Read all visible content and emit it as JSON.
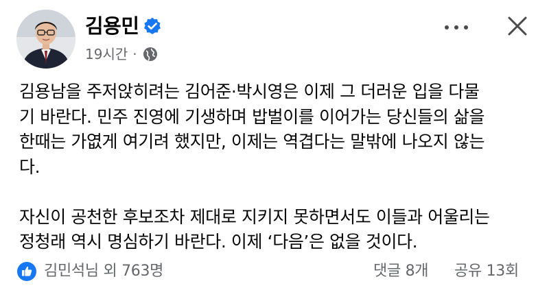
{
  "post": {
    "author": {
      "name": "김용민",
      "verified": true,
      "avatar": "profile-photo"
    },
    "meta": {
      "time": "19시간",
      "separator": "·",
      "audience_icon": "globe-icon"
    },
    "actions": {
      "more_icon": "more-icon",
      "close_icon": "close-icon"
    },
    "body": {
      "paragraph_1_lines": [
        "김용남을 주저앉히려는 김어준·박시영은 이제 그 더러운 입을 다물",
        "기 바란다. 민주 진영에 기생하며 밥벌이를 이어가는 당신들의 삶을",
        "한때는 가엾게 여기려 했지만, 이제는 역겹다는 말밖에 나오지 않는",
        "다."
      ],
      "paragraph_2_lines": [
        "자신이 공천한 후보조차 제대로 지키지 못하면서도 이들과 어울리는",
        "정청래 역시 명심하기 바란다. 이제 ‘다음’은 없을 것이다."
      ]
    },
    "footer": {
      "reaction_icon": "like-icon",
      "reactions": "김민석님 외 763명",
      "comments": "댓글 8개",
      "shares": "공유 13회"
    }
  },
  "colors": {
    "facebook_blue": "#1877f2",
    "text_primary": "#050505",
    "text_secondary": "#65676b"
  }
}
